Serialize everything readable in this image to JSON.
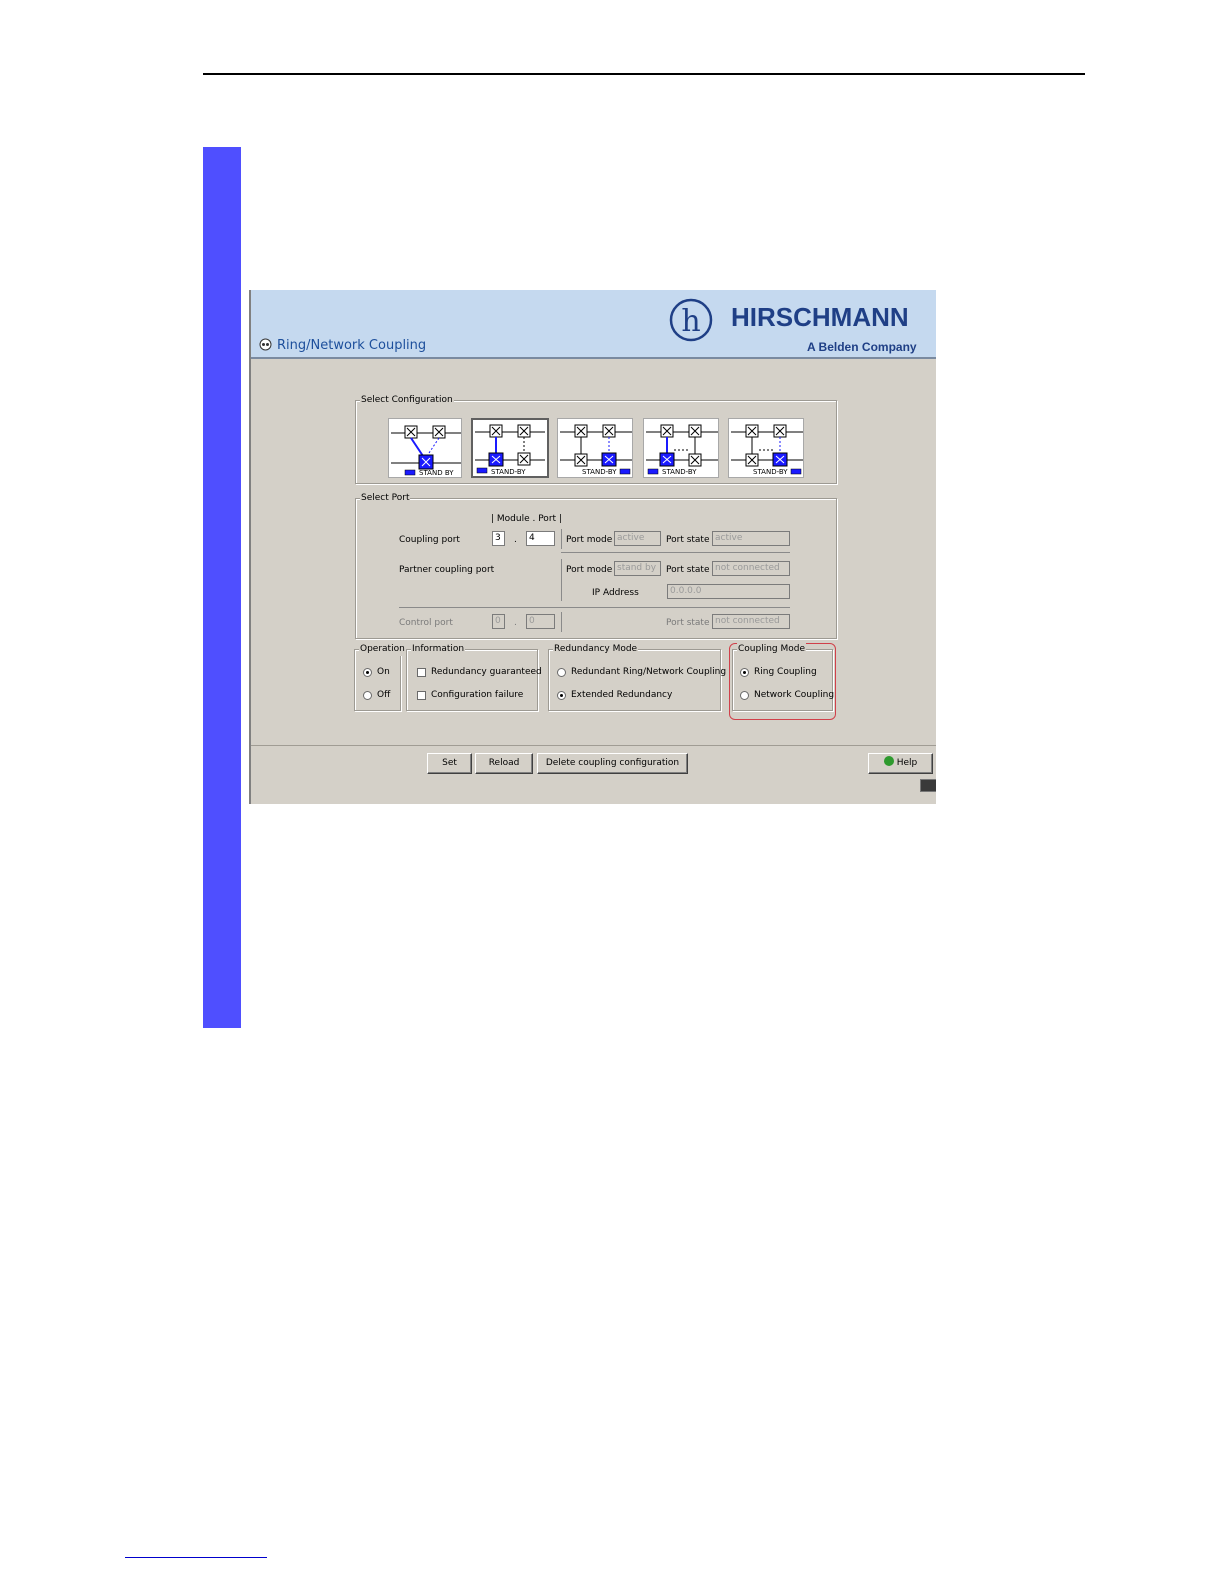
{
  "window": {
    "title": "Ring/Network Coupling",
    "brand": "HIRSCHMANN",
    "brand_sub": "A Belden Company",
    "logo_letter": "h"
  },
  "select_configuration": {
    "label": "Select Configuration",
    "options": [
      {
        "caption": "STAND BY",
        "selected": false
      },
      {
        "caption": "STAND-BY",
        "selected": true
      },
      {
        "caption": "STAND-BY",
        "selected": false
      },
      {
        "caption": "STAND-BY",
        "selected": false
      },
      {
        "caption": "STAND-BY",
        "selected": false
      }
    ]
  },
  "select_port": {
    "label": "Select Port",
    "module_port_header": "| Module . Port |",
    "coupling_port": {
      "label": "Coupling port",
      "module": "3",
      "dot": ".",
      "port": "4",
      "port_mode_label": "Port mode",
      "port_mode": "active",
      "port_state_label": "Port state",
      "port_state": "active"
    },
    "partner_coupling_port": {
      "label": "Partner coupling port",
      "port_mode_label": "Port mode",
      "port_mode": "stand by",
      "port_state_label": "Port state",
      "port_state": "not connected",
      "ip_label": "IP Address",
      "ip": "0.0.0.0"
    },
    "control_port": {
      "label": "Control port",
      "module": "0",
      "dot": ".",
      "port": "0",
      "port_state_label": "Port state",
      "port_state": "not connected"
    }
  },
  "operation": {
    "label": "Operation",
    "options": [
      "On",
      "Off"
    ],
    "selected": "On"
  },
  "information": {
    "label": "Information",
    "items": [
      "Redundancy guaranteed",
      "Configuration failure"
    ]
  },
  "redundancy_mode": {
    "label": "Redundancy Mode",
    "options": [
      "Redundant Ring/Network Coupling",
      "Extended Redundancy"
    ],
    "selected": "Extended Redundancy"
  },
  "coupling_mode": {
    "label": "Coupling Mode",
    "options": [
      "Ring Coupling",
      "Network Coupling"
    ],
    "selected": "Ring Coupling"
  },
  "buttons": {
    "set": "Set",
    "reload": "Reload",
    "delete": "Delete coupling configuration",
    "help": "Help"
  },
  "colors": {
    "page_bar": "#4f4fff",
    "header_bg": "#c5d9ef",
    "brand": "#1f3f86",
    "highlight": "#d0404a",
    "switch_blue": "#1a1aff"
  }
}
